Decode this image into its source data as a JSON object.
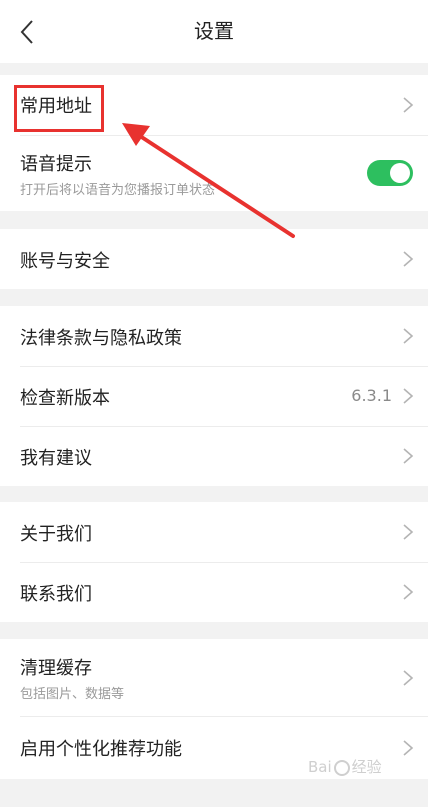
{
  "header": {
    "title": "设置"
  },
  "sections": {
    "address": {
      "title": "常用地址"
    },
    "voice": {
      "title": "语音提示",
      "subtitle": "打开后将以语音为您播报订单状态",
      "enabled": true
    },
    "account": {
      "title": "账号与安全"
    },
    "legal": {
      "title": "法律条款与隐私政策"
    },
    "update": {
      "title": "检查新版本",
      "version": "6.3.1"
    },
    "feedback": {
      "title": "我有建议"
    },
    "about": {
      "title": "关于我们"
    },
    "contact": {
      "title": "联系我们"
    },
    "cache": {
      "title": "清理缓存",
      "subtitle": "包括图片、数据等"
    },
    "personalize": {
      "title": "启用个性化推荐功能"
    }
  },
  "watermark": {
    "brand_a": "Bai",
    "brand_b": "经验"
  },
  "colors": {
    "accent_green": "#2dbf5f",
    "highlight_red": "#e8322f"
  },
  "icons": {
    "back": "chevron-left-icon",
    "row": "chevron-right-icon"
  }
}
